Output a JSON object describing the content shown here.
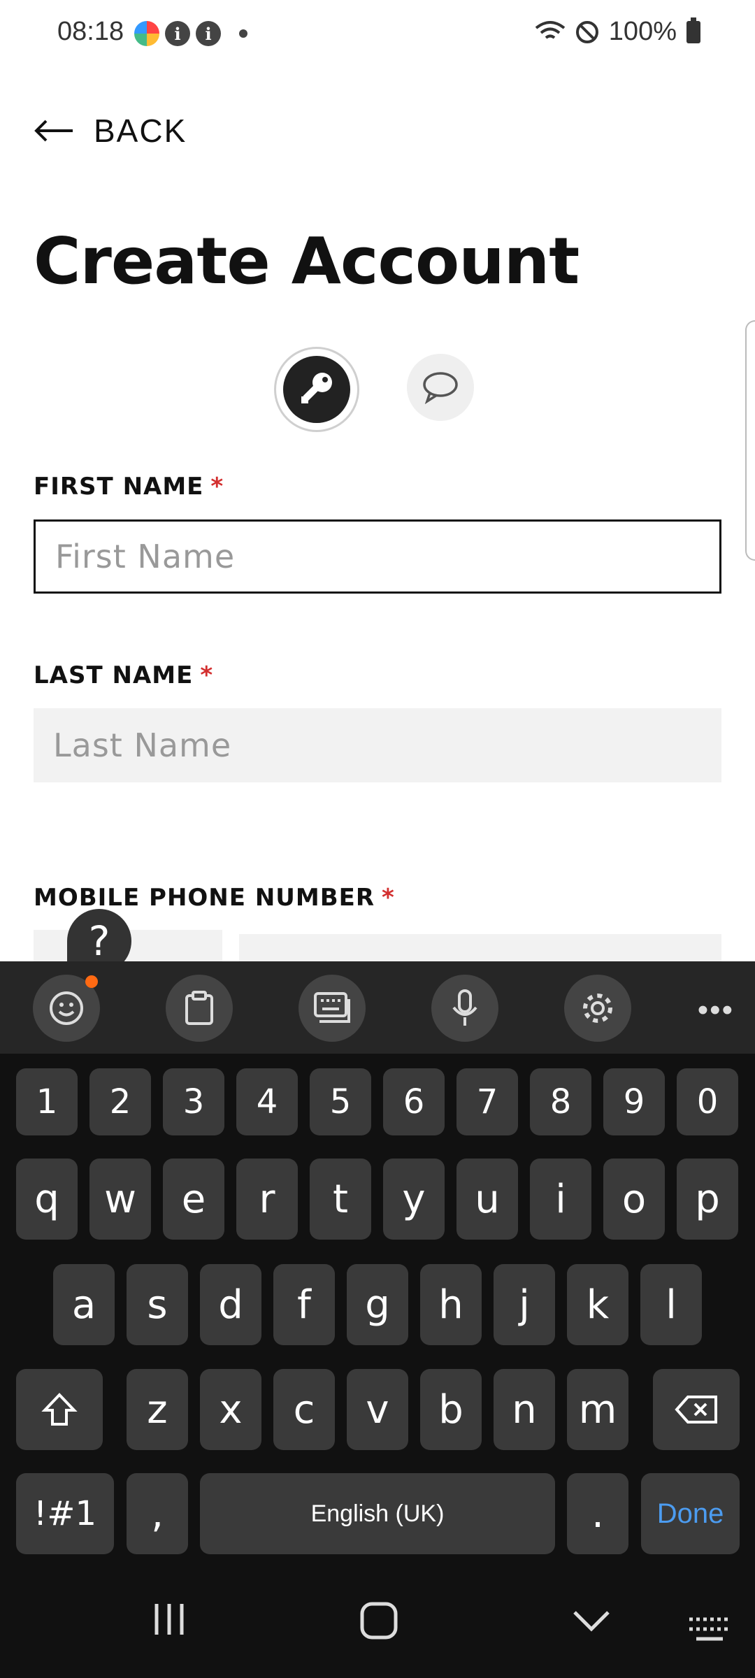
{
  "status_bar": {
    "time": "08:18",
    "battery": "100%"
  },
  "header": {
    "back_label": "BACK",
    "title": "Create Account"
  },
  "form": {
    "first_name": {
      "label": "FIRST NAME",
      "required": "*",
      "placeholder": "First Name"
    },
    "last_name": {
      "label": "LAST NAME",
      "required": "*",
      "placeholder": "Last Name"
    },
    "mobile": {
      "label": "MOBILE PHONE NUMBER",
      "required": "*"
    }
  },
  "help": {
    "label": "?"
  },
  "keyboard": {
    "row_numbers": [
      "1",
      "2",
      "3",
      "4",
      "5",
      "6",
      "7",
      "8",
      "9",
      "0"
    ],
    "row_1": [
      "q",
      "w",
      "e",
      "r",
      "t",
      "y",
      "u",
      "i",
      "o",
      "p"
    ],
    "row_2": [
      "a",
      "s",
      "d",
      "f",
      "g",
      "h",
      "j",
      "k",
      "l"
    ],
    "row_3": [
      "z",
      "x",
      "c",
      "v",
      "b",
      "n",
      "m"
    ],
    "symbols_label": "!#1",
    "comma": ",",
    "space_label": "English (UK)",
    "period": ".",
    "done_label": "Done"
  },
  "colors": {
    "accent_required": "#d32f2f",
    "done_key": "#4c9cf0",
    "notification_dot": "#ff6a13"
  }
}
